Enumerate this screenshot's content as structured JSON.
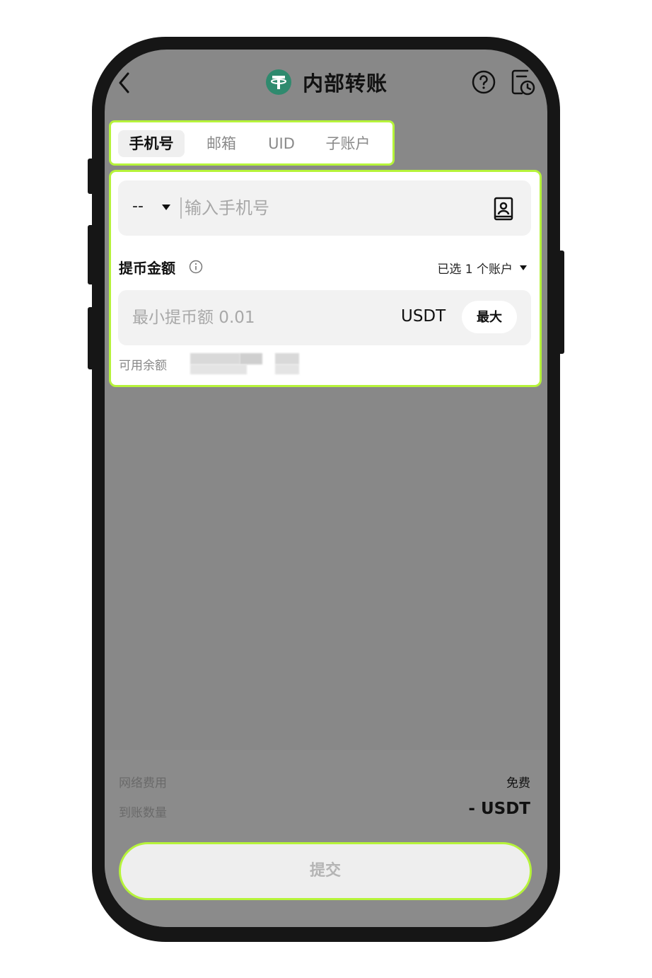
{
  "header": {
    "title": "内部转账",
    "back_icon": "chevron-left-icon",
    "coin_icon": "tether-icon",
    "help_icon": "help-circle-icon",
    "history_icon": "history-icon"
  },
  "tabs": [
    {
      "label": "手机号",
      "active": true
    },
    {
      "label": "邮箱",
      "active": false
    },
    {
      "label": "UID",
      "active": false
    },
    {
      "label": "子账户",
      "active": false
    }
  ],
  "phone": {
    "country_code": "--",
    "placeholder": "输入手机号",
    "contact_icon": "contact-book-icon"
  },
  "amount": {
    "label": "提币金额",
    "account_select": "已选 1 个账户",
    "placeholder": "最小提币额 0.01",
    "currency": "USDT",
    "max_label": "最大",
    "balance_label": "可用余额"
  },
  "footer": {
    "fee_label": "网络费用",
    "fee_value": "免费",
    "receive_label": "到账数量",
    "receive_value": "- USDT",
    "submit_label": "提交"
  },
  "colors": {
    "highlight": "#b6f33a",
    "tether_green": "#2f8a6e",
    "overlay": "#888888"
  }
}
